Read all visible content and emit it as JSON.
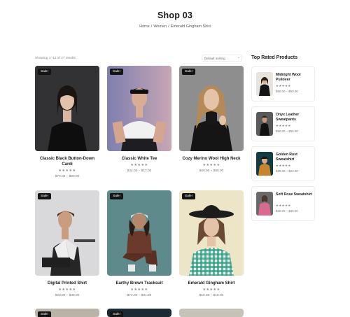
{
  "header": {
    "title": "Shop 03",
    "breadcrumb": [
      "Home",
      "Women",
      "Emerald Gingham Shirt"
    ]
  },
  "toolbar": {
    "results_text": "Showing 1–12 of 27 results",
    "sort_selected": "Default sorting"
  },
  "products": [
    {
      "name": "Classic Black Button-Down Cardi",
      "price": "$70.00 – $90.00",
      "badge": "Sale!",
      "rating": 5
    },
    {
      "name": "Classic White Tee",
      "price": "$34.00 – $17.00",
      "badge": "Sale!",
      "rating": 5
    },
    {
      "name": "Cozy Merino Wool High Neck",
      "price": "$60.00 – $65.00",
      "badge": "Sale!",
      "rating": 5
    },
    {
      "name": "Digital Printed Shirt",
      "price": "$20.00 – $35.00",
      "badge": "Sale!",
      "rating": 5
    },
    {
      "name": "Earthy Brown Tracksuit",
      "price": "$72.00 – $81.00",
      "badge": "Sale!",
      "rating": 5
    },
    {
      "name": "Emerald Gingham Shirt",
      "price": "$15.00 – $18.00",
      "badge": "Sale!",
      "rating": 5
    }
  ],
  "next_row_badge": "Sale!",
  "sidebar": {
    "title": "Top Rated Products",
    "items": [
      {
        "name": "Midnight Wool Pullover",
        "price": "$50.00 – $60.00",
        "rating": 5
      },
      {
        "name": "Onyx Leather Sweatpants",
        "price": "$50.00 – $55.00",
        "rating": 5
      },
      {
        "name": "Golden Rust Sweatshirt",
        "price": "$20.00 – $24.00",
        "rating": 5
      },
      {
        "name": "Soft Rose Sweatshirt",
        "price": "$30.00 – $36.00",
        "rating": 5
      }
    ]
  },
  "stars_glyph": "★★★★★",
  "colors": {
    "badge_bg": "#141414",
    "text": "#1a1a1a",
    "muted": "#888888"
  }
}
